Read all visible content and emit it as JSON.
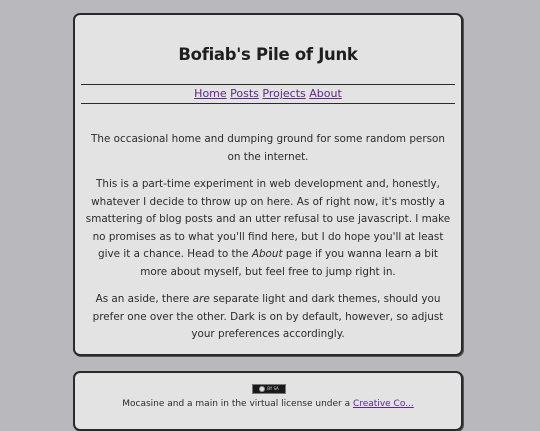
{
  "site": {
    "title": "Bofiab's Pile of Junk"
  },
  "nav": {
    "items": [
      {
        "label": "Home"
      },
      {
        "label": "Posts"
      },
      {
        "label": "Projects"
      },
      {
        "label": "About"
      }
    ]
  },
  "content": {
    "p1": "The occasional home and dumping ground for some random person on the internet.",
    "p2_part1": "This is a part-time experiment in web development and, honestly, whatever I decide to throw up on here. As of right now, it's mostly a smattering of blog posts and an utter refusal to use javascript. I make no promises as to what you'll find here, but I do hope you'll at least give it a chance. Head to the ",
    "p2_em": "About",
    "p2_part2": " page if you wanna learn a bit more about myself, but feel free to jump right in.",
    "p3_part1": "As an aside, there ",
    "p3_em": "are",
    "p3_part2": " separate light and dark themes, should you prefer one over the other. Dark is on by default, however, so adjust your preferences accordingly."
  },
  "footer": {
    "badge_text": "BY SA",
    "license_text": "Mocasine and a main in the virtual license under a ",
    "license_link": "Creative Co..."
  },
  "colors": {
    "background": "#b9b9bd",
    "card": "#e3e3e3",
    "link": "#5b2a86",
    "border": "#2a2a2a"
  }
}
